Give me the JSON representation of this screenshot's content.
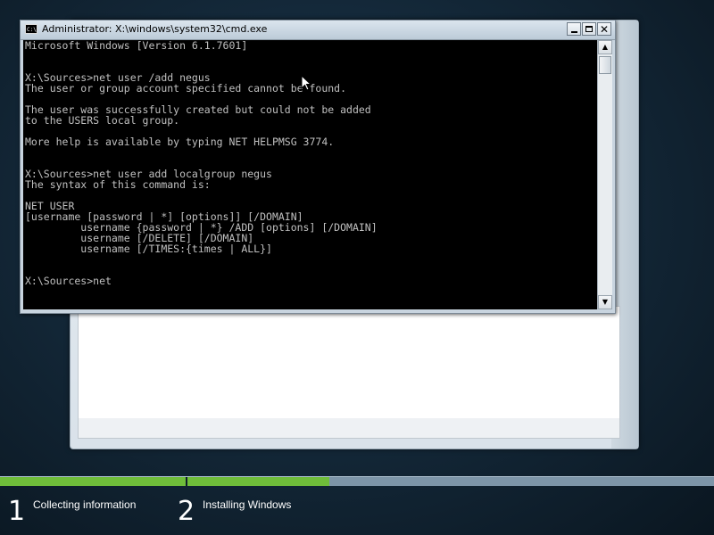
{
  "setup": {
    "window_title": "",
    "steps": [
      {
        "number": "1",
        "label": "Collecting information"
      },
      {
        "number": "2",
        "label": "Installing Windows"
      }
    ],
    "progress": {
      "collecting_information": 1.0,
      "installing_windows": 0.27
    },
    "progress_color": "#6fbd3a"
  },
  "cmd": {
    "title": "Administrator: X:\\windows\\system32\\cmd.exe",
    "icon": "cmd-icon",
    "icon_text": "C:\\",
    "buttons": {
      "minimize": "minimize",
      "maximize": "maximize",
      "close": "✕"
    },
    "lines": [
      "Microsoft Windows [Version 6.1.7601]",
      "",
      "",
      "X:\\Sources>net user /add negus",
      "The user or group account specified cannot be found.",
      "",
      "The user was successfully created but could not be added",
      "to the USERS local group.",
      "",
      "More help is available by typing NET HELPMSG 3774.",
      "",
      "",
      "X:\\Sources>net user add localgroup negus",
      "The syntax of this command is:",
      "",
      "NET USER",
      "[username [password | *] [options]] [/DOMAIN]",
      "         username {password | *} /ADD [options] [/DOMAIN]",
      "         username [/DELETE] [/DOMAIN]",
      "         username [/TIMES:{times | ALL}]",
      "",
      "",
      "X:\\Sources>net"
    ]
  }
}
